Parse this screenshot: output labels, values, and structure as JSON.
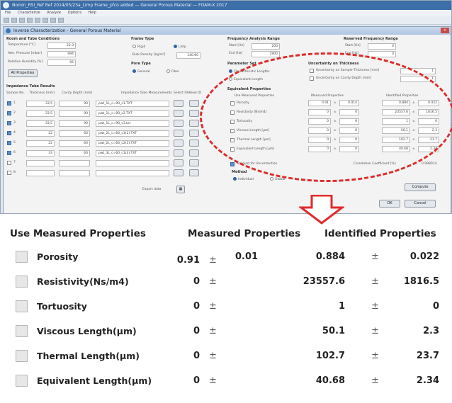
{
  "background_app": {
    "window_title": "Nomin_RSI_Ref Ref 2014/05/23a_Limp Frame_pfco added — General Porous Material — FOAM-X 2017",
    "menu": [
      "File",
      "Characterize",
      "Analyze",
      "Options",
      "Help"
    ],
    "dialog_title": "Inverse Characterization - General Porous Material",
    "room_section": "Room and Tube Conditions",
    "temperature_label": "Temperature [°C]",
    "temperature_value": "22.3",
    "pressure_label": "Atm. Pressure [mbar]",
    "pressure_value": "994",
    "humidity_label": "Relative Humidity [%]",
    "humidity_value": "56",
    "all_properties_button": "All Properties",
    "frame_type_label": "Frame Type",
    "rigid_label": "Rigid",
    "limp_label": "Limp",
    "bulk_density_label": "Bulk Density [kg/m³]",
    "bulk_density_value": "140.60",
    "pore_type_label": "Pore Type",
    "general_label": "General",
    "fiber_label": "Fiber",
    "freq_range_label": "Frequency Analysis Range",
    "freq_start_label": "Start [Hz]",
    "freq_start_value": "200",
    "freq_end_label": "End [Hz]",
    "freq_end_value": "1900",
    "reserved_range_label": "Reserved Frequency Range",
    "res_start_label": "Start [Hz]",
    "res_start_value": "0",
    "res_end_label": "End [Hz]",
    "res_end_value": "0",
    "param_set_label": "Parameter Set",
    "char_lengths_label": "Characteristic Lengths",
    "equiv_length_label": "Equivalent Length",
    "uncertainty_thickness_label": "Uncertainty on Thickness",
    "unc_sample_label": "Uncertainty on Sample Thickness [mm]",
    "unc_sample_value": "1",
    "unc_cavity_label": "Uncertainty on Cavity Depth [mm]",
    "unc_cavity_value": "1",
    "impedance_label": "Impedance Tube Results",
    "imp_headers": [
      "Sample No.",
      "Thickness [mm]",
      "Cavity Depth [mm]",
      "Impedance Tube Measurements",
      "Select File",
      "View ID"
    ],
    "imp_rows": [
      {
        "no": "1",
        "thk": "33.5",
        "cav": "90",
        "file": "pwt_1L_c=90_c1.TXT"
      },
      {
        "no": "2",
        "thk": "33.5",
        "cav": "90",
        "file": "pwt_1L_c=90_c2.TXT"
      },
      {
        "no": "3",
        "thk": "33.5",
        "cav": "90",
        "file": "pwt_1L_c=90_c3.txt"
      },
      {
        "no": "4",
        "thk": "22",
        "cav": "60",
        "file": "pwt_2L_c=60_c1(2).TXT"
      },
      {
        "no": "5",
        "thk": "22",
        "cav": "60",
        "file": "pwt_2L_c=60_c2(3).TXT"
      },
      {
        "no": "6",
        "thk": "33",
        "cav": "60",
        "file": "pwt_3L_c=60_c1(3).TXT"
      },
      {
        "no": "7",
        "thk": "",
        "cav": "",
        "file": ""
      },
      {
        "no": "8",
        "thk": "",
        "cav": "",
        "file": ""
      }
    ],
    "export_label": "Export data",
    "equiv_props_label": "Equivalent Properties",
    "mini_headers": [
      "Use Measured Properties",
      "Measured Properties",
      "Identified Properties"
    ],
    "mini_rows": [
      {
        "name": "Porosity",
        "m": "0.91",
        "mu": "0.014",
        "i": "0.884",
        "iu": "0.022"
      },
      {
        "name": "Resistivity [Ns/m4]",
        "m": "0",
        "mu": "0",
        "i": "23557.6",
        "iu": "1816.5"
      },
      {
        "name": "Tortuosity",
        "m": "0",
        "mu": "0",
        "i": "1",
        "iu": "0"
      },
      {
        "name": "Viscous Length [µm]",
        "m": "0",
        "mu": "0",
        "i": "50.1",
        "iu": "2.3"
      },
      {
        "name": "Thermal Length [µm]",
        "m": "0",
        "mu": "0",
        "i": "102.7",
        "iu": "23.7"
      },
      {
        "name": "Equivalent Length [µm]",
        "m": "0",
        "mu": "0",
        "i": "40.68",
        "iu": "2.34"
      }
    ],
    "account_uncert_label": "Account for Uncertainties",
    "correlation_label": "Correlation Coefficient [%]",
    "correlation_value": "0.998014",
    "method_label": "Method",
    "individual_label": "Individual",
    "global_label": "Global",
    "compute_button": "Compute",
    "ok_button": "OK",
    "cancel_button": "Cancel"
  },
  "zoom_panel": {
    "headers": {
      "use": "Use Measured Properties",
      "measured": "Measured Properties",
      "identified": "Identified Properties"
    },
    "pm_symbol": "±",
    "rows": [
      {
        "name": "Porosity",
        "measured": "0.91",
        "measured_unc": "0.01",
        "identified": "0.884",
        "identified_unc": "0.022"
      },
      {
        "name": "Resistivity(Ns/m4)",
        "measured": "0",
        "measured_unc": "",
        "identified": "23557.6",
        "identified_unc": "1816.5"
      },
      {
        "name": "Tortuosity",
        "measured": "0",
        "measured_unc": "",
        "identified": "1",
        "identified_unc": "0"
      },
      {
        "name": "Viscous Length(µm)",
        "measured": "0",
        "measured_unc": "",
        "identified": "50.1",
        "identified_unc": "2.3"
      },
      {
        "name": "Thermal Length(µm)",
        "measured": "0",
        "measured_unc": "",
        "identified": "102.7",
        "identified_unc": "23.7"
      },
      {
        "name": "Equivalent Length(µm)",
        "measured": "0",
        "measured_unc": "",
        "identified": "40.68",
        "identified_unc": "2.34"
      }
    ]
  },
  "colors": {
    "highlight": "#e02a2a",
    "title_bar": "#3c6ea8"
  }
}
